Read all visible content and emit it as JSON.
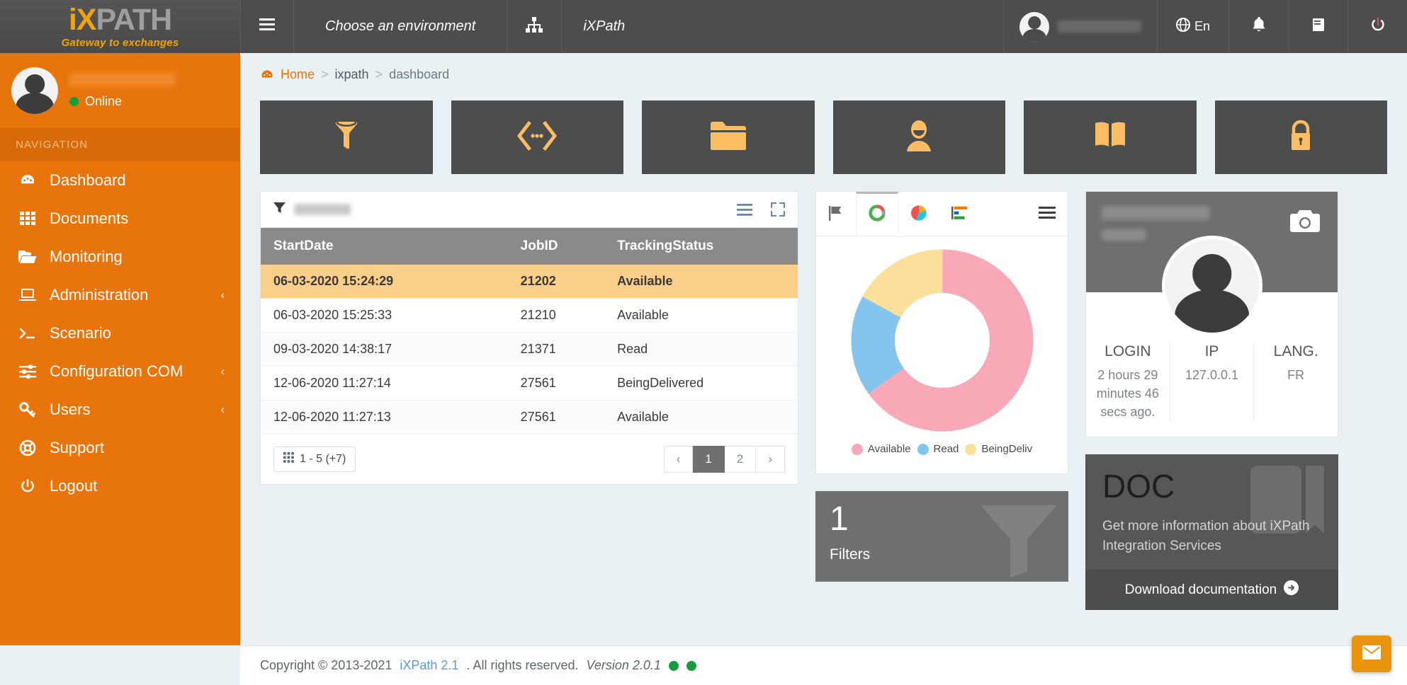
{
  "brand": {
    "logo_ix": "iX",
    "logo_path": "PATH",
    "tagline": "Gateway to exchanges"
  },
  "topbar": {
    "menu_icon": "hamburger-icon",
    "environment_label": "Choose an environment",
    "sitemap_icon": "sitemap-icon",
    "app_name": "iXPath",
    "user_name": "",
    "language": "En",
    "notifications_icon": "bell-icon",
    "docs_icon": "book-icon",
    "power_icon": "power-icon"
  },
  "sidebar": {
    "profile": {
      "name": "",
      "status": "Online"
    },
    "nav_header": "NAVIGATION",
    "items": [
      {
        "label": "Dashboard",
        "icon": "dashboard-icon",
        "caret": ""
      },
      {
        "label": "Documents",
        "icon": "grid-icon",
        "caret": ""
      },
      {
        "label": "Monitoring",
        "icon": "folder-icon",
        "caret": ""
      },
      {
        "label": "Administration",
        "icon": "laptop-icon",
        "caret": "‹"
      },
      {
        "label": "Scenario",
        "icon": "terminal-icon",
        "caret": ""
      },
      {
        "label": "Configuration COM",
        "icon": "sliders-icon",
        "caret": "‹"
      },
      {
        "label": "Users",
        "icon": "key-icon",
        "caret": "‹"
      },
      {
        "label": "Support",
        "icon": "lifering-icon",
        "caret": ""
      },
      {
        "label": "Logout",
        "icon": "power-icon",
        "caret": ""
      }
    ]
  },
  "breadcrumb": {
    "home": "Home",
    "mid": "ixpath",
    "current": "dashboard",
    "sep": ">"
  },
  "tiles": [
    {
      "name": "filter-tile",
      "icon": "funnel-icon"
    },
    {
      "name": "exchange-tile",
      "icon": "code-arrows-icon"
    },
    {
      "name": "folder-tile",
      "icon": "folder-icon"
    },
    {
      "name": "user-tile",
      "icon": "user-icon"
    },
    {
      "name": "book-tile",
      "icon": "book-open-icon"
    },
    {
      "name": "lock-tile",
      "icon": "lock-icon"
    }
  ],
  "table_panel": {
    "filter_label": "",
    "list_icon": "list-icon",
    "expand_icon": "expand-icon",
    "columns": [
      "StartDate",
      "JobID",
      "TrackingStatus"
    ],
    "rows": [
      {
        "startdate": "06-03-2020 15:24:29",
        "jobid": "21202",
        "status": "Available",
        "selected": true
      },
      {
        "startdate": "06-03-2020 15:25:33",
        "jobid": "21210",
        "status": "Available",
        "selected": false
      },
      {
        "startdate": "09-03-2020 14:38:17",
        "jobid": "21371",
        "status": "Read",
        "selected": false
      },
      {
        "startdate": "12-06-2020 11:27:14",
        "jobid": "27561",
        "status": "BeingDelivered",
        "selected": false
      },
      {
        "startdate": "12-06-2020 11:27:13",
        "jobid": "27561",
        "status": "Available",
        "selected": false
      }
    ],
    "pagination": {
      "count_label": "1 - 5 (+7)",
      "prev": "‹",
      "next": "›",
      "pages": [
        "1",
        "2"
      ],
      "active_page": "1"
    }
  },
  "chart_panel": {
    "tabs": [
      {
        "name": "tab-flag",
        "icon": "flag-icon",
        "active": false
      },
      {
        "name": "tab-donut",
        "icon": "donut-icon",
        "active": true
      },
      {
        "name": "tab-pie",
        "icon": "pie-icon",
        "active": false
      },
      {
        "name": "tab-bar",
        "icon": "bar-icon",
        "active": false
      },
      {
        "name": "tab-menu",
        "icon": "hamburger-icon",
        "active": false
      }
    ]
  },
  "chart_data": {
    "type": "pie",
    "variant": "donut",
    "title": "",
    "categories": [
      "Available",
      "Read",
      "BeingDeliv"
    ],
    "values": [
      65,
      18,
      17
    ],
    "colors": [
      "#f9a8b8",
      "#85c5ed",
      "#fbdf9b"
    ],
    "legend_position": "bottom",
    "inner_radius_ratio": 0.52
  },
  "kpi": {
    "number": "1",
    "label": "Filters",
    "icon": "funnel-icon"
  },
  "profile": {
    "name": "",
    "role": "",
    "camera_icon": "camera-icon",
    "stats": [
      {
        "key": "LOGIN",
        "value": "2 hours 29 minutes 46 secs ago."
      },
      {
        "key": "IP",
        "value": "127.0.0.1"
      },
      {
        "key": "LANG.",
        "value": "FR"
      }
    ]
  },
  "doc": {
    "title": "DOC",
    "text": "Get more information about iXPath Integration Services",
    "button": "Download documentation",
    "button_icon": "arrow-right-circle-icon",
    "bookmark_icon": "bookmark-icon"
  },
  "footer": {
    "copyright_pre": "Copyright © 2013-2021 ",
    "link": "iXPath 2.1",
    "copyright_post": ". All rights reserved. ",
    "version": "Version 2.0.1"
  },
  "mail_button": {
    "icon": "envelope-icon"
  },
  "colors": {
    "brand_orange": "#e8740c",
    "accent_amber": "#fbbe63",
    "dark_panel": "#4d4d4d",
    "page_bg": "#eaf1f5",
    "selected_row": "#f9cf8a",
    "online_green": "#1a9c3e"
  }
}
